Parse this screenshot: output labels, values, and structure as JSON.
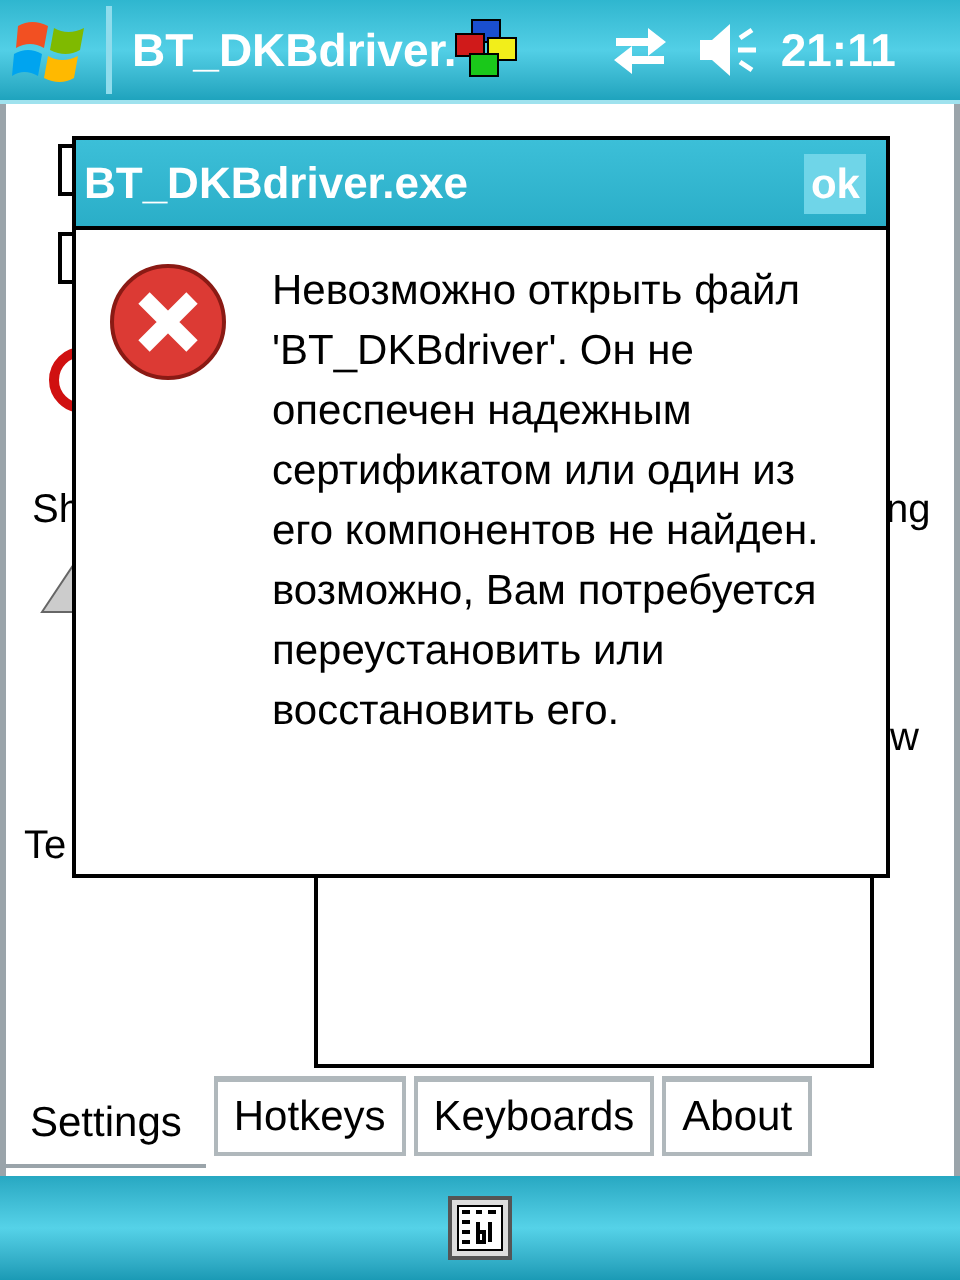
{
  "top_bar": {
    "title": "BT_DKBdriver.",
    "time": "21:11"
  },
  "background": {
    "fragments": [
      "Sh",
      "ng",
      "w",
      "Te"
    ]
  },
  "dialog": {
    "title": "BT_DKBdriver.exe",
    "ok": "ok",
    "message": "Невозможно открыть файл  'BT_DKBdriver'. Он не опеспечен надежным сертификатом или один из его компонентов не найден. возможно, Вам потребуется переустановить или восстановить его."
  },
  "tabs": [
    {
      "label": "Settings",
      "selected": true
    },
    {
      "label": "Hotkeys",
      "selected": false
    },
    {
      "label": "Keyboards",
      "selected": false
    },
    {
      "label": "About",
      "selected": false
    }
  ]
}
